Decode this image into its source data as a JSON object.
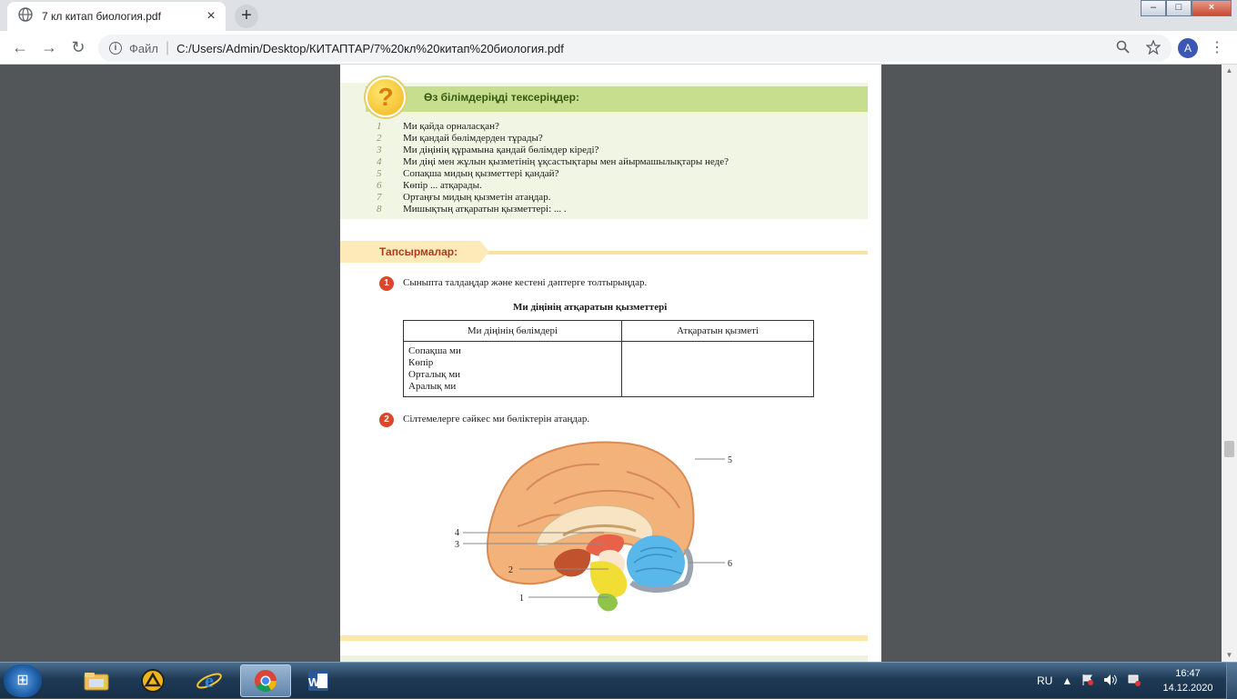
{
  "browser": {
    "tab_title": "7 кл китап биология.pdf",
    "new_tab_label": "+",
    "tab_close": "×",
    "nav": {
      "back": "←",
      "forward": "→",
      "reload": "↻"
    },
    "scheme_label": "Файл",
    "url": "C:/Users/Admin/Desktop/КИТАПТАР/7%20кл%20китап%20биология.pdf",
    "avatar_letter": "A",
    "window_buttons": {
      "minimize": "–",
      "maximize": "□",
      "close": "×"
    }
  },
  "document": {
    "check_title": "Өз білімдеріңді тексеріңдер:",
    "questions": [
      {
        "n": "1",
        "text": "Ми қайда орналасқан?"
      },
      {
        "n": "2",
        "text": "Ми қандай бөлімдерден тұрады?"
      },
      {
        "n": "3",
        "text": "Ми діңінің құрамына қандай бөлімдер кіреді?"
      },
      {
        "n": "4",
        "text": "Ми діңі мен жұлын қызметінің ұқсастықтары мен айырмашылықтары неде?"
      },
      {
        "n": "5",
        "text": "Сопақша мидың қызметтері қандай?"
      },
      {
        "n": "6",
        "text": "Көпір ... атқарады."
      },
      {
        "n": "7",
        "text": "Ортаңғы мидың қызметін атаңдар."
      },
      {
        "n": "8",
        "text": "Мишықтың атқаратын қызметтері: ... ."
      }
    ],
    "tasks_title": "Тапсырмалар:",
    "task1": {
      "num": "1",
      "text": "Сыныпта талдаңдар және кестені дәптерге толтырыңдар."
    },
    "table_title": "Ми діңінің атқаратын қызметтері",
    "table_headers": [
      "Ми діңінің бөлімдері",
      "Атқаратын қызметі"
    ],
    "table_parts": [
      "Сопақша ми",
      "Көпір",
      "Орталық ми",
      "Аралық ми"
    ],
    "task2": {
      "num": "2",
      "text": "Сілтемелерге сәйкес ми бөліктерін атаңдар."
    },
    "brain_labels": [
      "1",
      "2",
      "3",
      "4",
      "5",
      "6"
    ]
  },
  "taskbar": {
    "language": "RU",
    "time": "16:47",
    "date": "14.12.2020",
    "apps": [
      "explorer",
      "media-player",
      "internet-explorer",
      "chrome",
      "word"
    ]
  },
  "colors": {
    "accent_green": "#c7de8e",
    "task_red": "#b23a1c",
    "badge_orange": "#f2b21a"
  }
}
